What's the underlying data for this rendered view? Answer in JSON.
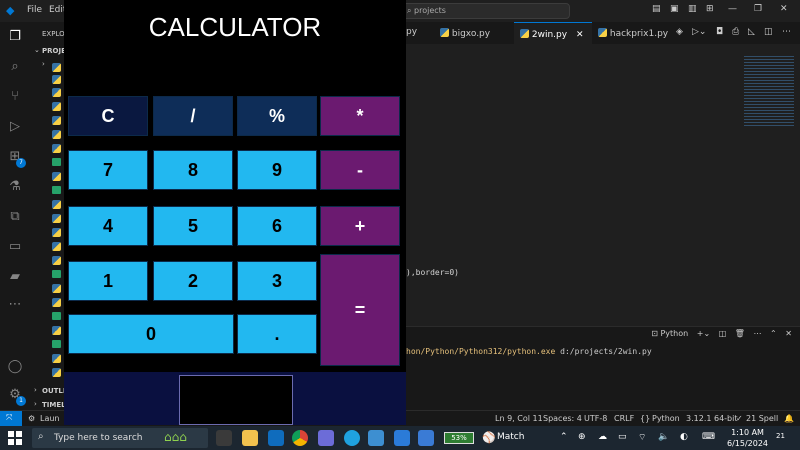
{
  "vscode": {
    "menu": [
      "File",
      "Edit"
    ],
    "command_center": "projects",
    "explorer_label": "EXPLO",
    "project_label": "PROJE",
    "outline_label": "OUTLI",
    "timeline_label": "TIMEL",
    "launch_label": "Laun",
    "extensions_badge": "7",
    "accounts_badge": "1",
    "tabs": [
      {
        "label": "py",
        "active": false
      },
      {
        "label": "bigxo.py",
        "active": false
      },
      {
        "label": "2win.py",
        "active": true
      },
      {
        "label": "hackprix1.py",
        "active": false
      }
    ],
    "code_fragment": "),border=0)",
    "panel_label": "Python",
    "terminal_text_path": "hon/Python/Python312/python.exe",
    "terminal_text_arg": " d:/projects/2win.py",
    "status": {
      "position": "Ln 9, Col 11",
      "spaces": "Spaces: 4",
      "encoding": "UTF-8",
      "eol": "CRLF",
      "language": "Python",
      "interpreter": "3.12.1 64-bit",
      "spell": "21 Spell"
    }
  },
  "calculator": {
    "title": "CALCULATOR",
    "keys": [
      {
        "label": "C",
        "style": "dark"
      },
      {
        "label": "/",
        "style": "navy"
      },
      {
        "label": "%",
        "style": "navy"
      },
      {
        "label": "*",
        "style": "op"
      },
      {
        "label": "7",
        "style": "light"
      },
      {
        "label": "8",
        "style": "light"
      },
      {
        "label": "9",
        "style": "light"
      },
      {
        "label": "-",
        "style": "op"
      },
      {
        "label": "4",
        "style": "light"
      },
      {
        "label": "5",
        "style": "light"
      },
      {
        "label": "6",
        "style": "light"
      },
      {
        "label": "+",
        "style": "op"
      },
      {
        "label": "1",
        "style": "light"
      },
      {
        "label": "2",
        "style": "light"
      },
      {
        "label": "3",
        "style": "light"
      },
      {
        "label": "=",
        "style": "op"
      },
      {
        "label": "0",
        "style": "light"
      },
      {
        "label": ".",
        "style": "light"
      }
    ],
    "display_value": ""
  },
  "taskbar": {
    "search_placeholder": "Type here to search",
    "battery": "53%",
    "weather_label": "Match",
    "time": "1:10 AM",
    "date": "6/15/2024",
    "notifications": "21"
  },
  "colors": {
    "accent": "#0078d4",
    "calc_light": "#22b8f0",
    "calc_op": "#6b1a70",
    "calc_dark": "#0a1840"
  }
}
